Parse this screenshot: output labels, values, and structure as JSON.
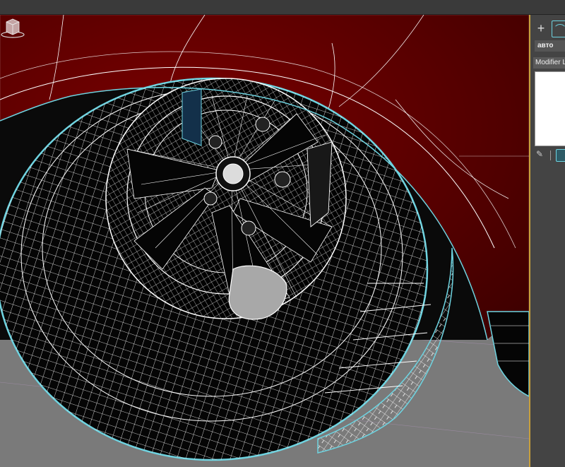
{
  "command_panel": {
    "create_icon": "plus-icon",
    "modify_icon": "modify-curve-icon",
    "object_name": "авто",
    "modifier_list_label": "Modifier List"
  },
  "viewport": {
    "content": "wireframe-car-wheel",
    "colors": {
      "body_red": "#8b0000",
      "wire_white": "#ffffff",
      "selection_cyan": "#6ed3e0",
      "floor_gray": "#7a7a7a",
      "tire_black": "#050505"
    }
  }
}
